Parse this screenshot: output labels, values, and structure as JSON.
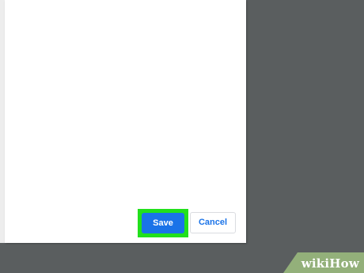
{
  "dialog": {
    "save_label": "Save",
    "cancel_label": "Cancel"
  },
  "colors": {
    "background": "#5a5e5f",
    "dialog_background": "#ffffff",
    "save_button": "#1a73e8",
    "cancel_text": "#1a73e8",
    "highlight": "#22e01c",
    "watermark_background": "#93b07a"
  },
  "watermark": {
    "text": "wikiHow"
  }
}
